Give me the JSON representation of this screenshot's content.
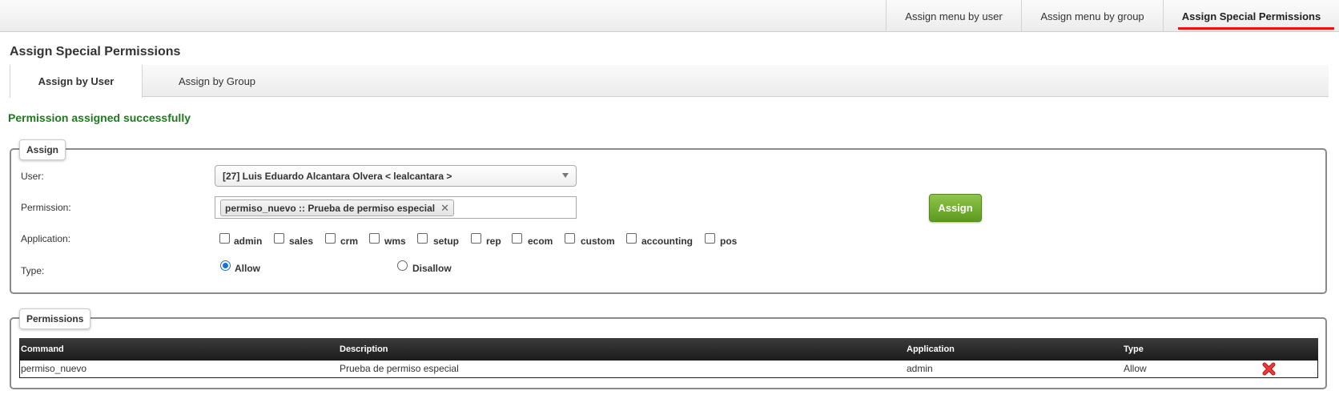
{
  "topnav": {
    "tabs": [
      {
        "label": "Assign menu by user"
      },
      {
        "label": "Assign menu by group"
      },
      {
        "label": "Assign Special Permissions"
      }
    ]
  },
  "page": {
    "title": "Assign Special Permissions",
    "subtabs": [
      {
        "label": "Assign by User"
      },
      {
        "label": "Assign by Group"
      }
    ],
    "success_message": "Permission assigned successfully"
  },
  "assign": {
    "legend": "Assign",
    "user_label": "User:",
    "user_value": "[27] Luis Eduardo Alcantara Olvera < lealcantara >",
    "permission_label": "Permission:",
    "permission_chip": "permiso_nuevo :: Prueba de permiso especial",
    "application_label": "Application:",
    "applications": [
      {
        "label": "admin",
        "checked": false
      },
      {
        "label": "sales",
        "checked": false
      },
      {
        "label": "crm",
        "checked": false
      },
      {
        "label": "wms",
        "checked": false
      },
      {
        "label": "setup",
        "checked": false
      },
      {
        "label": "rep",
        "checked": false
      },
      {
        "label": "ecom",
        "checked": false
      },
      {
        "label": "custom",
        "checked": false
      },
      {
        "label": "accounting",
        "checked": false
      },
      {
        "label": "pos",
        "checked": false
      }
    ],
    "type_label": "Type:",
    "type_options": [
      {
        "label": "Allow",
        "checked": true
      },
      {
        "label": "Disallow",
        "checked": false
      }
    ],
    "button_label": "Assign"
  },
  "permissions": {
    "legend": "Permissions",
    "columns": [
      "Command",
      "Description",
      "Application",
      "Type"
    ],
    "rows": [
      {
        "command": "permiso_nuevo",
        "description": "Prueba de permiso especial",
        "application": "admin",
        "type": "Allow"
      }
    ]
  },
  "colors": {
    "active_tab_underline": "#e11111",
    "success_text": "#1d7a1d",
    "assign_button": "#6aa62c",
    "table_header": "#262626",
    "delete_icon": "#e02424"
  }
}
